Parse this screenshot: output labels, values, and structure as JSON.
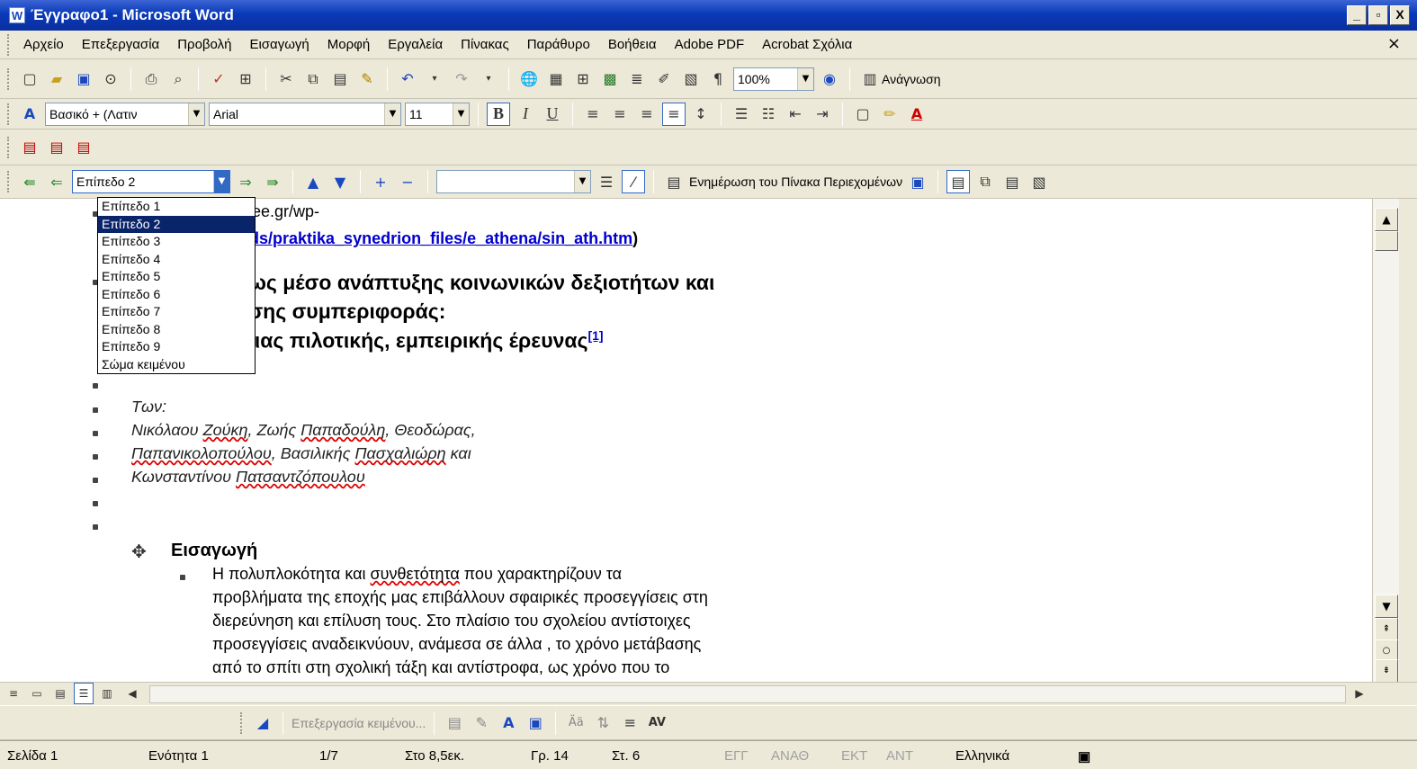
{
  "window": {
    "title": "Έγγραφο1 - Microsoft Word",
    "app_icon": "W",
    "min": "_",
    "max": "▫",
    "close": "X"
  },
  "menu": [
    "Αρχείο",
    "Επεξεργασία",
    "Προβολή",
    "Εισαγωγή",
    "Μορφή",
    "Εργαλεία",
    "Πίνακας",
    "Παράθυρο",
    "Βοήθεια",
    "Adobe PDF",
    "Acrobat Σχόλια"
  ],
  "menu_close": "×",
  "standard": {
    "zoom": "100%",
    "reading": "Ανάγνωση"
  },
  "formatting": {
    "style": "Βασικό + (Λατιν",
    "font": "Arial",
    "size": "11",
    "bold": "B",
    "italic": "I",
    "underline": "U"
  },
  "outline": {
    "level": "Επίπεδο 2",
    "update_toc": "Ενημέρωση του Πίνακα Περιεχομένων"
  },
  "level_options": [
    "Επίπεδο 1",
    "Επίπεδο 2",
    "Επίπεδο 3",
    "Επίπεδο 4",
    "Επίπεδο 5",
    "Επίπεδο 6",
    "Επίπεδο 7",
    "Επίπεδο 8",
    "Επίπεδο 9",
    "Σώμα κειμένου"
  ],
  "document": {
    "link1": "z.pee.gr/wp-",
    "link2": "oads/praktika_synedrion_files/e_athena/sin_ath.htm",
    "link2_tail": ")",
    "h1": "ή ως μέσο ανάπτυξης κοινωνικών δεξιοτήτων και",
    "h2": "ίησης συμπεριφοράς:",
    "h3": "ι μιας πιλοτικής, εμπειρικής έρευνας",
    "footnote": "[1]",
    "a1": "Των:",
    "a2a": "Νικόλαου ",
    "a2b": "Ζούκη",
    "a2c": ", Ζωής ",
    "a2d": "Παπαδούλη",
    "a2e": ", Θεοδώρας,",
    "a3a": "Παπανικολοπούλου",
    "a3b": ", Βασιλικής ",
    "a3c": "Πασχαλιώρη",
    "a3d": " και",
    "a4a": "Κωνσταντίνου ",
    "a4b": "Πατσαντζόπουλου",
    "section": "Εισαγωγή",
    "p1a": "Η πολυπλοκότητα και ",
    "p1b": "συνθετότητα",
    "p1c": " που χαρακτηρίζουν τα",
    "p2": "προβλήματα της εποχής μας επιβάλλουν σφαιρικές προσεγγίσεις στη",
    "p3": "διερεύνηση και επίλυση τους. Στο πλαίσιο του σχολείου αντίστοιχες",
    "p4": "προσεγγίσεις αναδεικνύουν, ανάμεσα σε άλλα , το χρόνο μετάβασης",
    "p5": "από το σπίτι στη σχολική τάξη και αντίστροφα, ως χρόνο που το"
  },
  "drawing": {
    "edit_text": "Επεξεργασία κειμένου..."
  },
  "status": {
    "page": "Σελίδα 1",
    "section": "Ενότητα 1",
    "pages": "1/7",
    "at": "Στο 8,5εκ.",
    "line": "Γρ. 14",
    "col": "Στ. 6",
    "rec": "ΕΓΓ",
    "trk": "ΑΝΑΘ",
    "ext": "ΕΚΤ",
    "ovr": "ΑΝΤ",
    "lang": "Ελληνικά"
  }
}
